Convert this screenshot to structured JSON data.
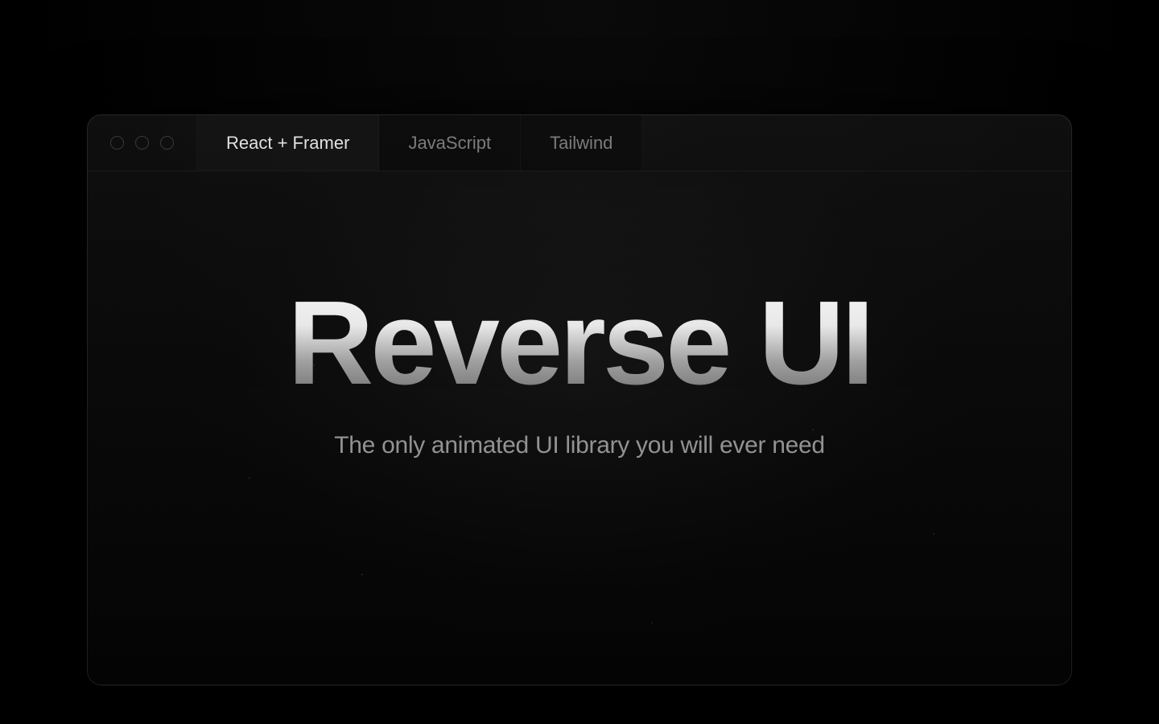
{
  "tabs": [
    {
      "label": "React + Framer",
      "active": true
    },
    {
      "label": "JavaScript",
      "active": false
    },
    {
      "label": "Tailwind",
      "active": false
    }
  ],
  "hero": {
    "title": "Reverse UI",
    "subtitle": "The only animated UI library you will ever need"
  }
}
